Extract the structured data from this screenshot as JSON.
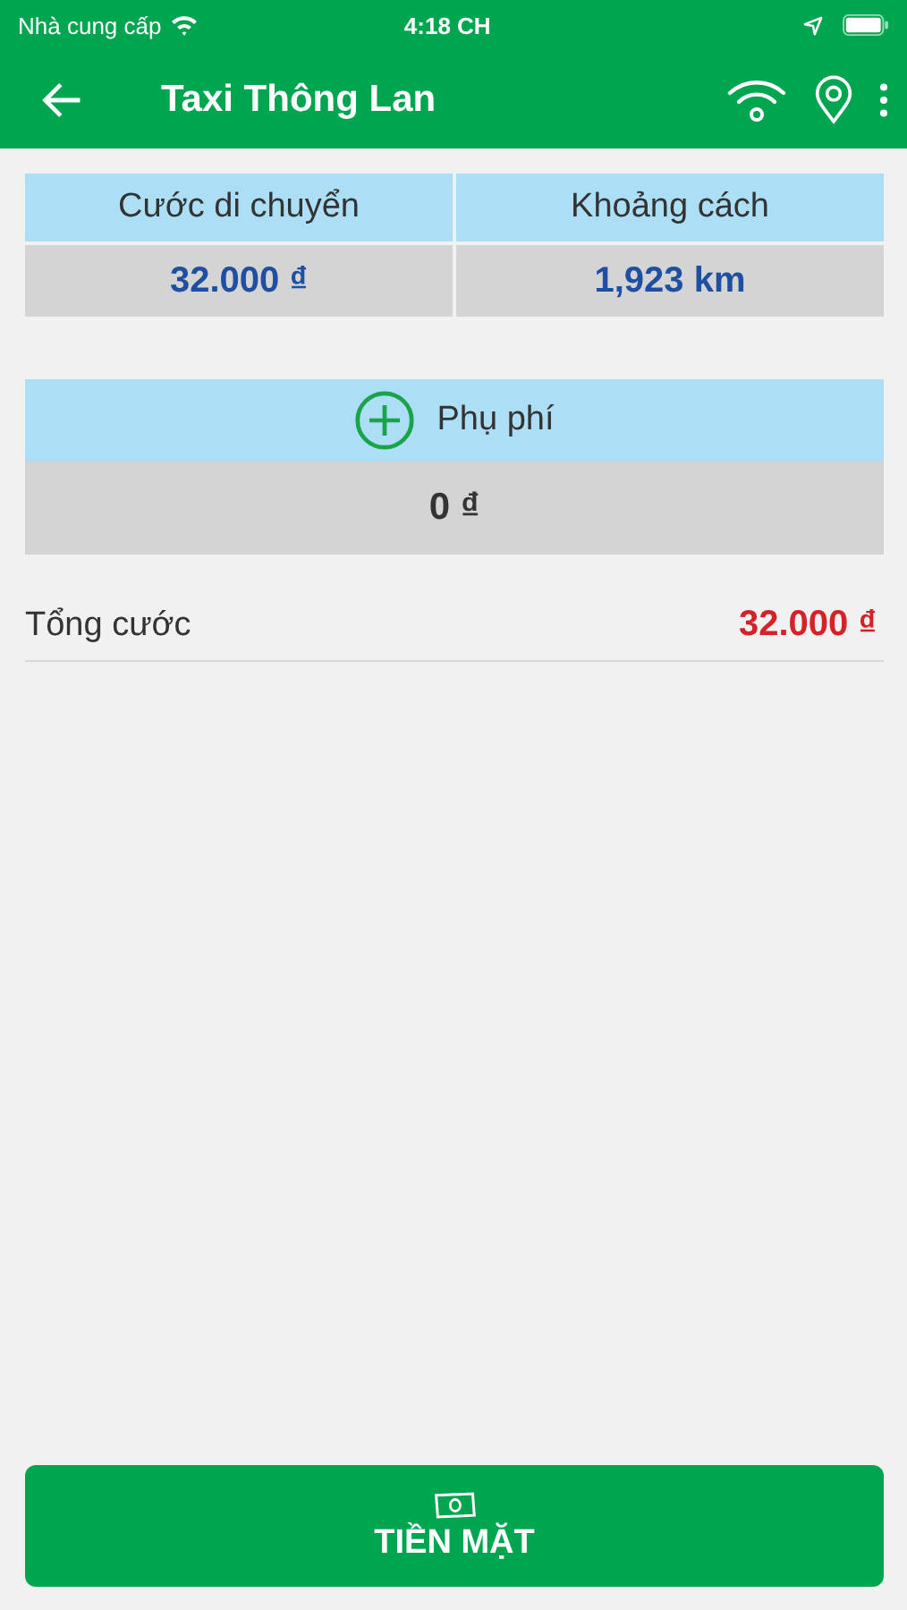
{
  "status_bar": {
    "carrier": "Nhà cung cấp",
    "time": "4:18 CH"
  },
  "app_bar": {
    "title": "Taxi Thông Lan"
  },
  "trip": [
    {
      "label": "Cước di chuyển",
      "value": "32.000 ₫"
    },
    {
      "label": "Khoảng cách",
      "value": "1,923 km"
    }
  ],
  "surcharge": {
    "label": "Phụ phí",
    "value": "0 ₫"
  },
  "total": {
    "label": "Tổng cước",
    "value": "32.000 ₫"
  },
  "pay_button": {
    "label": "TIỀN MẶT"
  }
}
